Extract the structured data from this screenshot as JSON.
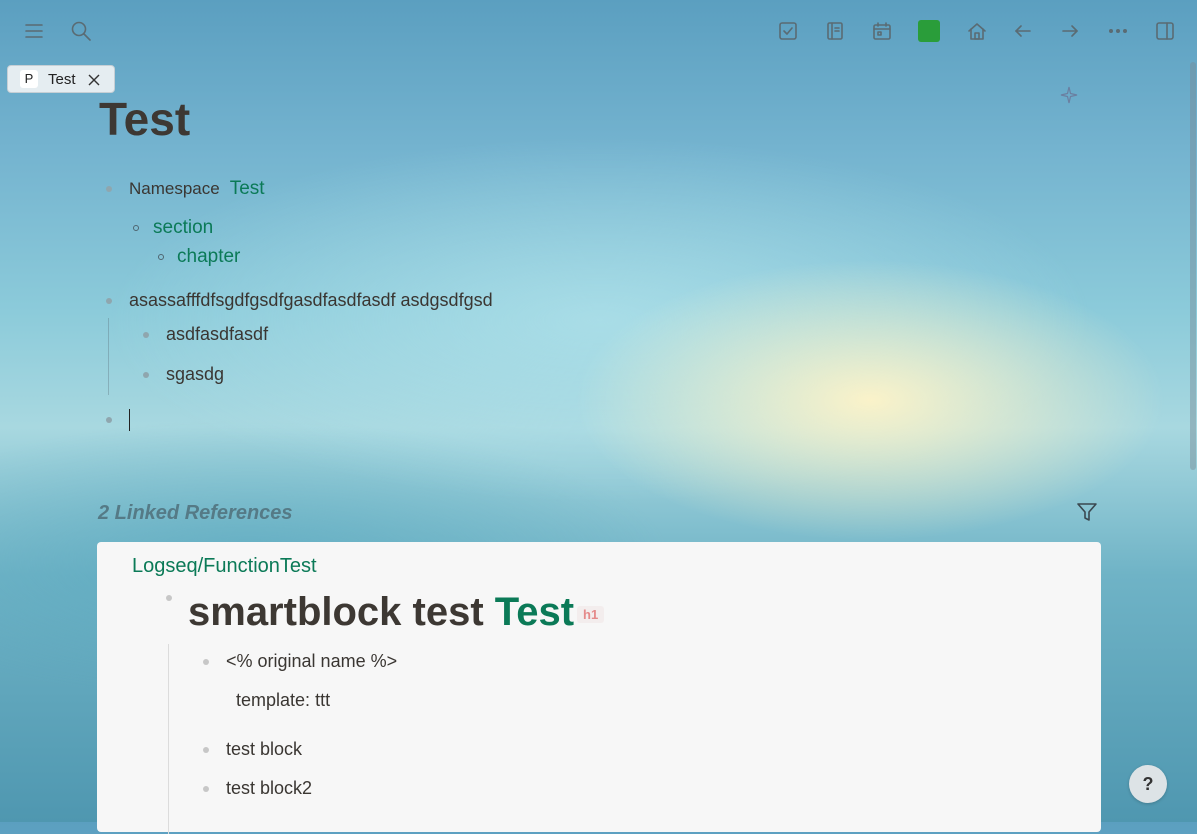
{
  "toolbar": {
    "left_icons": [
      "menu-icon",
      "search-icon"
    ],
    "right_icons": [
      "tasks-icon",
      "journal-icon",
      "calendar-icon",
      "color-swatch-icon",
      "home-icon",
      "back-arrow-icon",
      "forward-arrow-icon",
      "more-icon",
      "sidebar-toggle-icon"
    ],
    "swatch_color": "#2a9d3a"
  },
  "tab": {
    "prefix": "P",
    "label": "Test"
  },
  "page": {
    "title": "Test",
    "blocks": {
      "namespace_key": "Namespace",
      "namespace_value": "Test",
      "section": "section",
      "chapter": "chapter",
      "block2": "asassafffdfsgdfgsdfgasdfasdfasdf  asdgsdfgsd",
      "child1": "asdfasdfasdf",
      "child2": "sgasdg"
    }
  },
  "linked_refs": {
    "title": "2 Linked References",
    "page_name": "Logseq/FunctionTest",
    "heading_prefix": "smartblock test ",
    "heading_link": "Test",
    "heading_badge": "h1",
    "items": {
      "original_name": "<% original name %>",
      "prop_key": "template",
      "prop_sep": ": ",
      "prop_value": "ttt",
      "test_block": "test block",
      "test_block2": "test block2"
    }
  },
  "help_label": "?",
  "colors": {
    "link": "#0b7a57",
    "accent_green": "#2a9d3a"
  }
}
